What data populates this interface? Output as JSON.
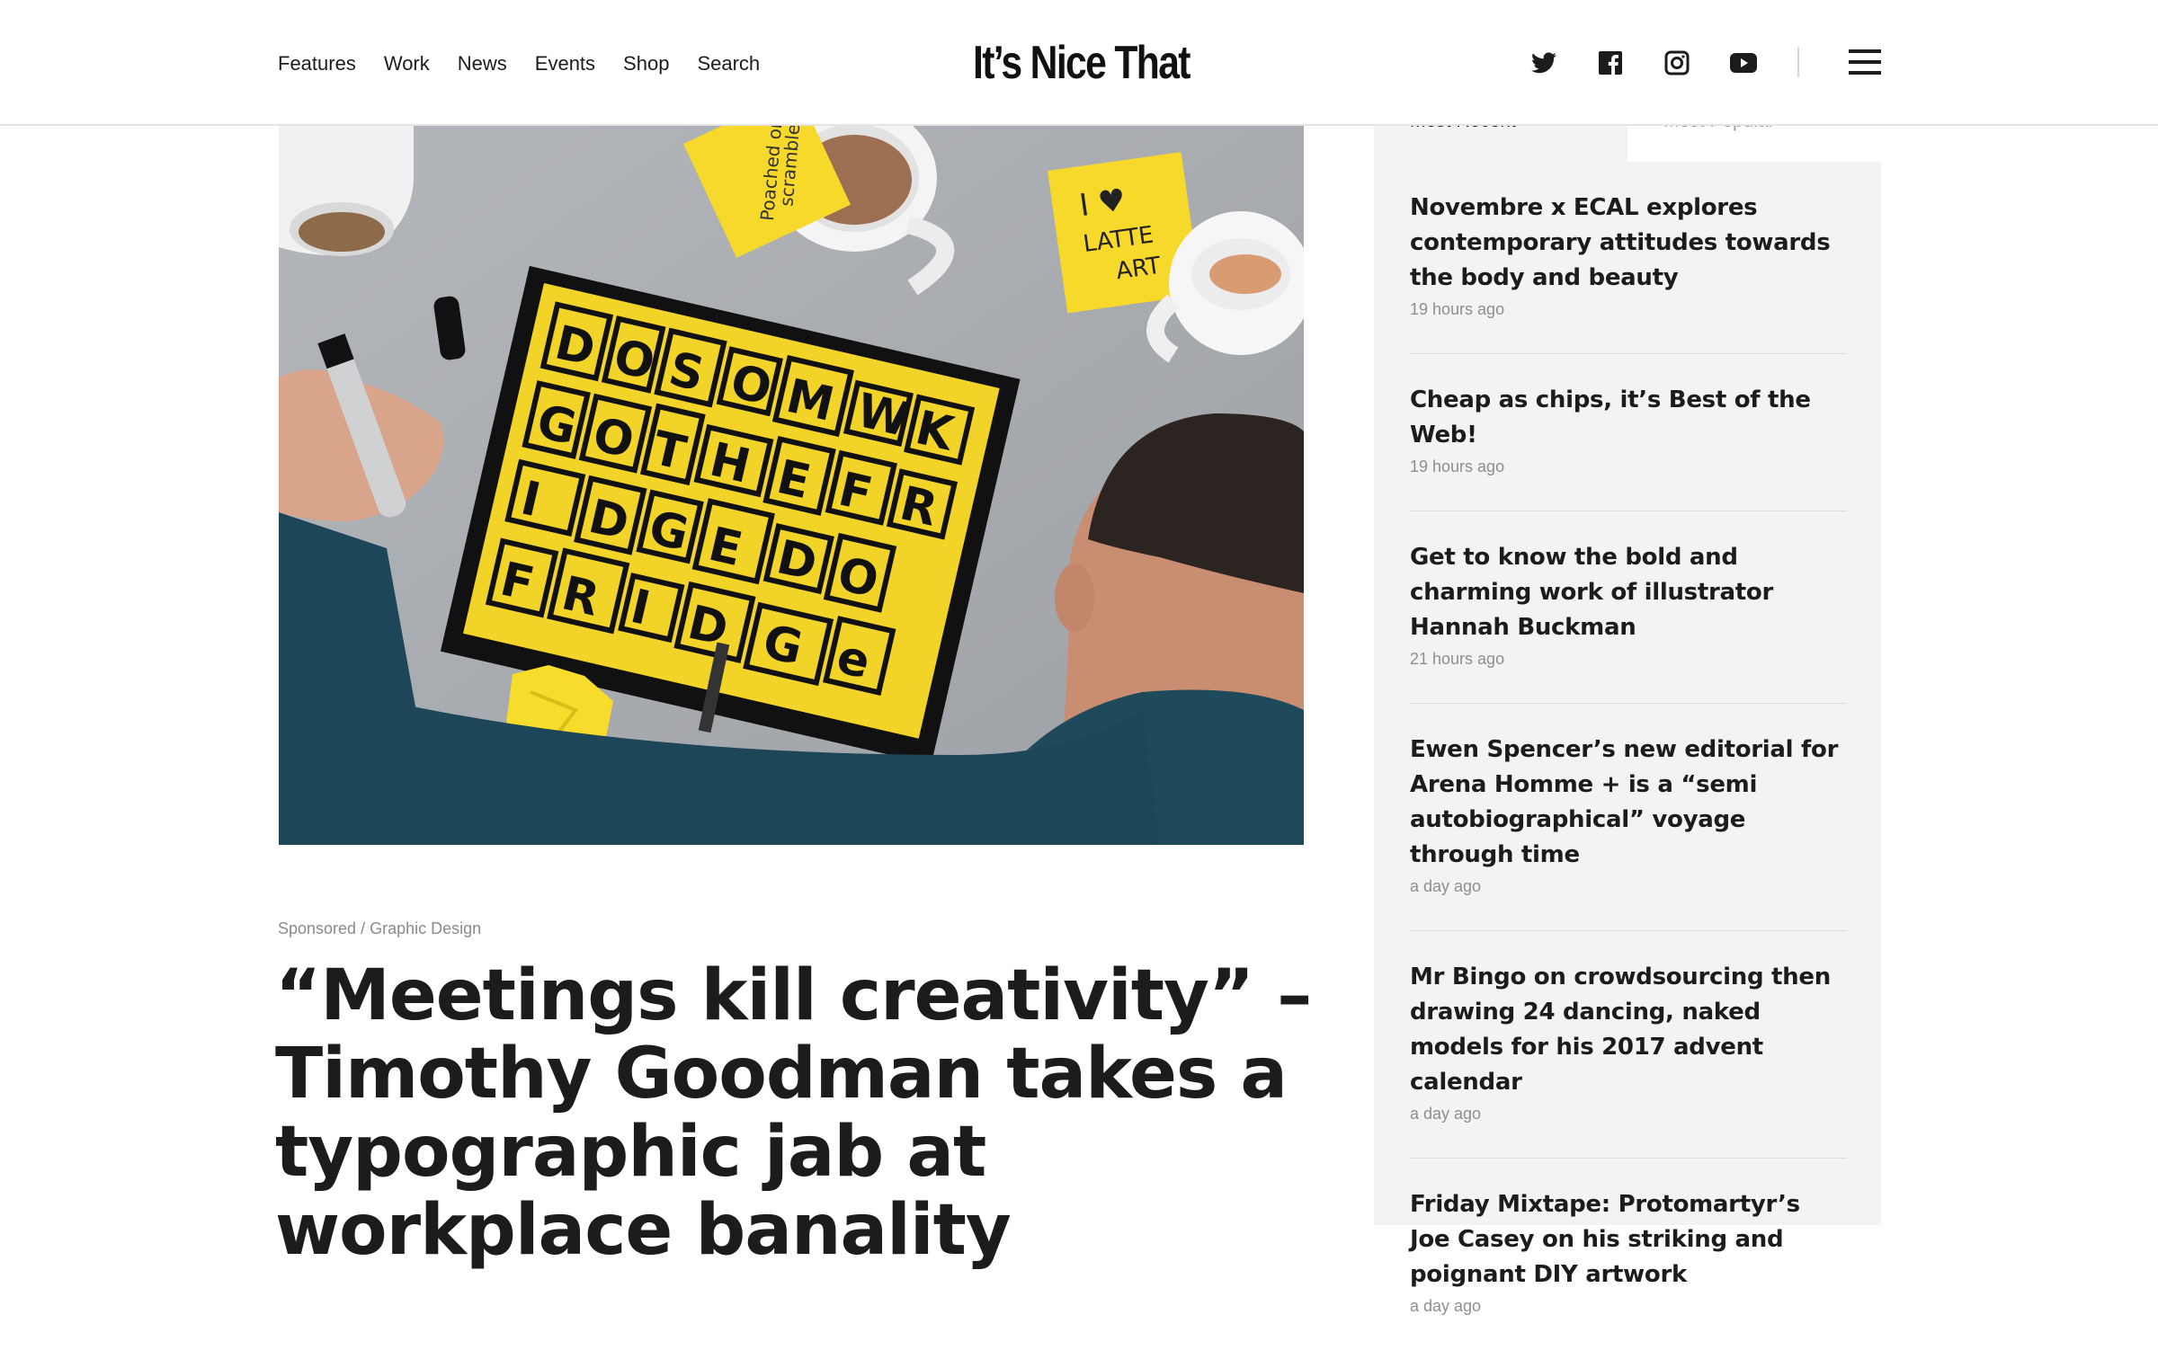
{
  "header": {
    "nav": [
      "Features",
      "Work",
      "News",
      "Events",
      "Shop",
      "Search"
    ],
    "logo": "It’s Nice That",
    "social_icons": [
      "twitter-icon",
      "facebook-icon",
      "instagram-icon",
      "youtube-icon"
    ],
    "menu_icon": "hamburger-menu-icon"
  },
  "hero": {
    "note_left": "Poached or scrambled?",
    "note_right": "I ♥ LATTE ART",
    "book_lettering": "DO SOME WORK GO TO THE FRIDGE DO SOME WORK GO TO THE FRIDGE"
  },
  "article": {
    "category": "Sponsored / Graphic Design",
    "headline": "“Meetings kill creativity” –  Timothy Goodman takes a typographic jab at workplace banality"
  },
  "sidebar": {
    "tabs": [
      "Most Recent",
      "Most Popular"
    ],
    "articles": [
      {
        "title": "Novembre x ECAL explores contemporary attitudes towards the body and beauty",
        "time": "19 hours ago"
      },
      {
        "title": "Cheap as chips, it’s Best of the Web!",
        "time": "19 hours ago"
      },
      {
        "title": "Get to know the bold and charming work of illustrator Hannah Buckman",
        "time": "21 hours ago"
      },
      {
        "title": "Ewen Spencer’s new editorial for Arena Homme + is a “semi autobiographical” voyage through time",
        "time": "a day ago"
      },
      {
        "title": "Mr Bingo on crowdsourcing then drawing 24 dancing, naked models for his 2017 advent calendar",
        "time": "a day ago"
      },
      {
        "title": "Friday Mixtape: Protomartyr’s Joe Casey on his striking and poignant DIY artwork",
        "time": "a day ago"
      }
    ]
  },
  "colors": {
    "text": "#1c1c1c",
    "muted": "#8e8e8e",
    "sidebar_bg": "#f3f3f3",
    "accent_yellow": "#f4dc2a"
  }
}
